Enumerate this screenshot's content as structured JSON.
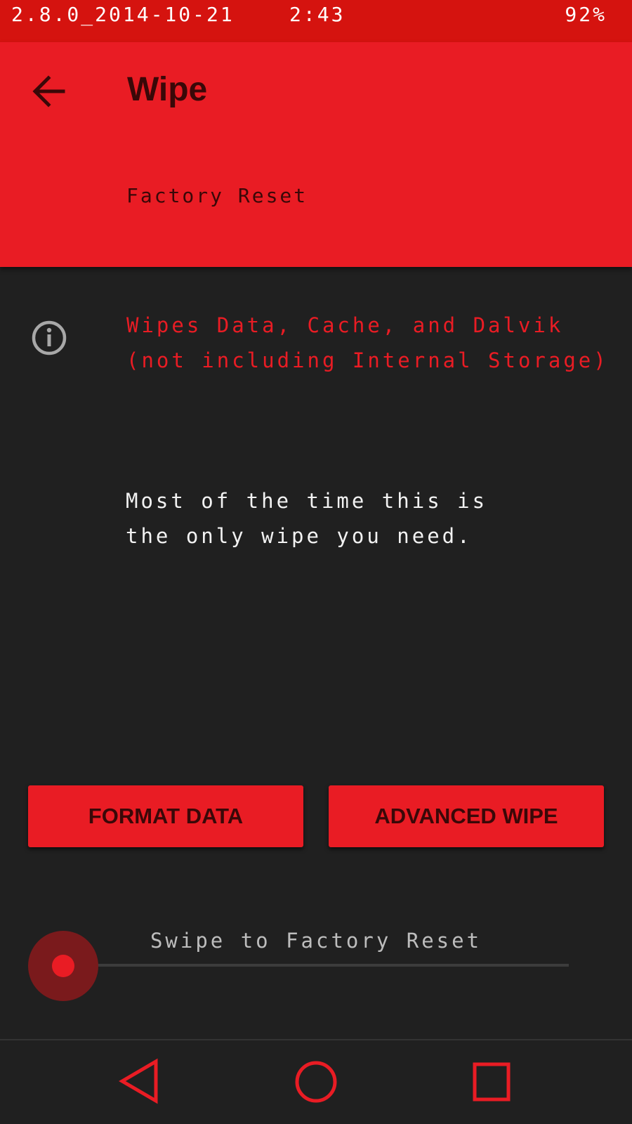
{
  "status_bar": {
    "version": "2.8.0_2014-10-21",
    "time": "2:43",
    "battery": "92%"
  },
  "header": {
    "back_icon": "arrow-left-icon",
    "title": "Wipe",
    "subtitle": "Factory Reset"
  },
  "info": {
    "icon": "info-icon",
    "line1": "Wipes Data, Cache, and Dalvik",
    "line2": "(not including Internal Storage)"
  },
  "description": {
    "line1": "Most of the time this is",
    "line2": "the only wipe you need."
  },
  "buttons": {
    "format_data": "FORMAT DATA",
    "advanced_wipe": "ADVANCED WIPE"
  },
  "swipe": {
    "label": "Swipe to Factory Reset",
    "progress": 0
  },
  "nav": {
    "back_icon": "triangle-back-icon",
    "home_icon": "circle-home-icon",
    "recent_icon": "square-recent-icon"
  },
  "colors": {
    "accent": "#e91c24",
    "status_bar": "#d5130f",
    "background": "#202020",
    "header_text": "#3a0808"
  }
}
